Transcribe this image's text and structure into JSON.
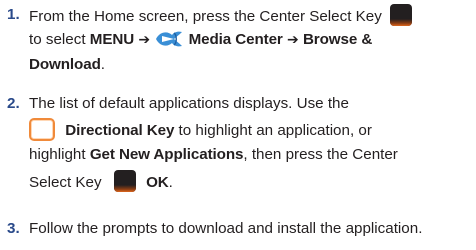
{
  "steps": [
    {
      "number": "1.",
      "line1_pre": "From the Home screen, press the Center Select Key",
      "line2_pre": "to select",
      "menu": "MENU",
      "arrow": "➔",
      "media_center": "Media Center",
      "browse_download_a": "Browse &",
      "browse_download_b": "Download",
      "period": ".",
      "center_key_icon": "center-select-key-icon",
      "media_icon": "media-center-icon"
    },
    {
      "number": "2.",
      "line1": "The list of default applications displays. Use the",
      "directional_key": "Directional Key",
      "line2_post": "to highlight an application, or",
      "line3_pre": "highlight",
      "get_new": "Get New Applications",
      "line3_post": ", then press the Center",
      "line4_pre": "Select Key",
      "ok": "OK",
      "period": ".",
      "dir_key_icon": "directional-key-icon"
    },
    {
      "number": "3.",
      "line1": "Follow the prompts to download and install the application."
    }
  ],
  "colors": {
    "text": "#231f20",
    "number": "#2a4a8a",
    "key_orange": "#f08a3a",
    "media_blue": "#3a8fd6"
  }
}
